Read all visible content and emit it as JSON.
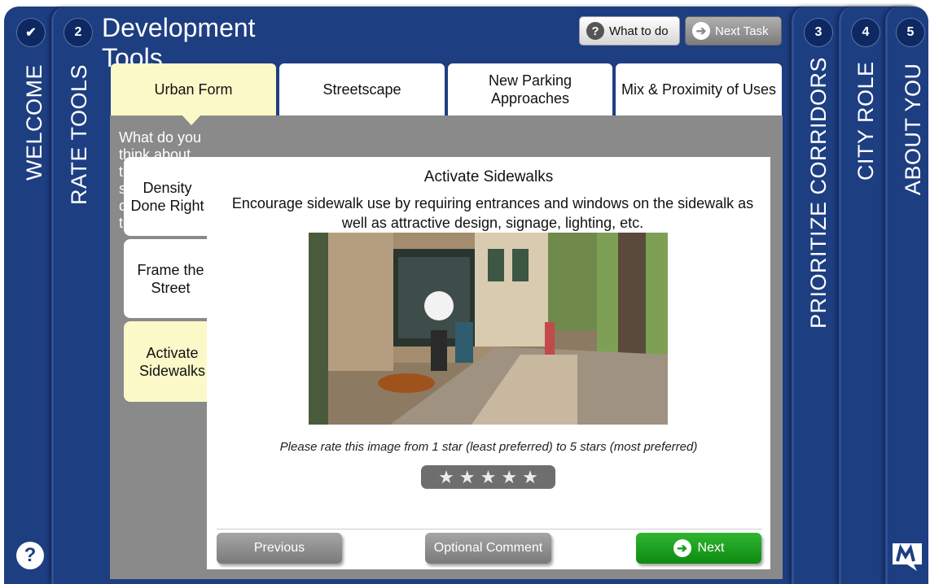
{
  "steps": {
    "welcome": {
      "label": "WELCOME",
      "icon": "checkmark-icon"
    },
    "rate_tools": {
      "number": "2",
      "label": "RATE TOOLS"
    },
    "prioritize_corridors": {
      "number": "3",
      "label": "PRIORITIZE CORRIDORS"
    },
    "city_role": {
      "number": "4",
      "label": "CITY ROLE"
    },
    "about_you": {
      "number": "5",
      "label": "ABOUT YOU"
    }
  },
  "header": {
    "title": "Development Tools",
    "what_to_do": "What to do",
    "next_task": "Next Task"
  },
  "top_tabs": [
    {
      "label": "Urban Form",
      "active": true
    },
    {
      "label": "Streetscape",
      "active": false
    },
    {
      "label": "New Parking Approaches",
      "active": false
    },
    {
      "label": "Mix & Proximity of Uses",
      "active": false
    }
  ],
  "question": "What do you think about these transit supportive development tools?",
  "side_tabs": [
    {
      "label": "Density Done Right",
      "active": false
    },
    {
      "label": "Frame the Street",
      "active": false
    },
    {
      "label": "Activate Sidewalks",
      "active": true
    }
  ],
  "content": {
    "title": "Activate Sidewalks",
    "description": "Encourage sidewalk use by requiring entrances and windows on the sidewalk as well as attractive design, signage, lighting, etc.",
    "rating_prompt": "Please rate this image from 1 star (least preferred) to 5 stars (most preferred)",
    "rating_value": 0,
    "rating_max": 5
  },
  "footer": {
    "previous": "Previous",
    "comment": "Optional Comment",
    "next": "Next"
  },
  "icons": {
    "help": "question-mark-icon",
    "logo": "brand-logo-icon",
    "arrow": "arrow-right-circle-icon"
  },
  "colors": {
    "nav_blue": "#1e3e82",
    "active_tab": "#fbf9c8",
    "panel_gray": "#8a8a8a",
    "next_green": "#129a16"
  }
}
